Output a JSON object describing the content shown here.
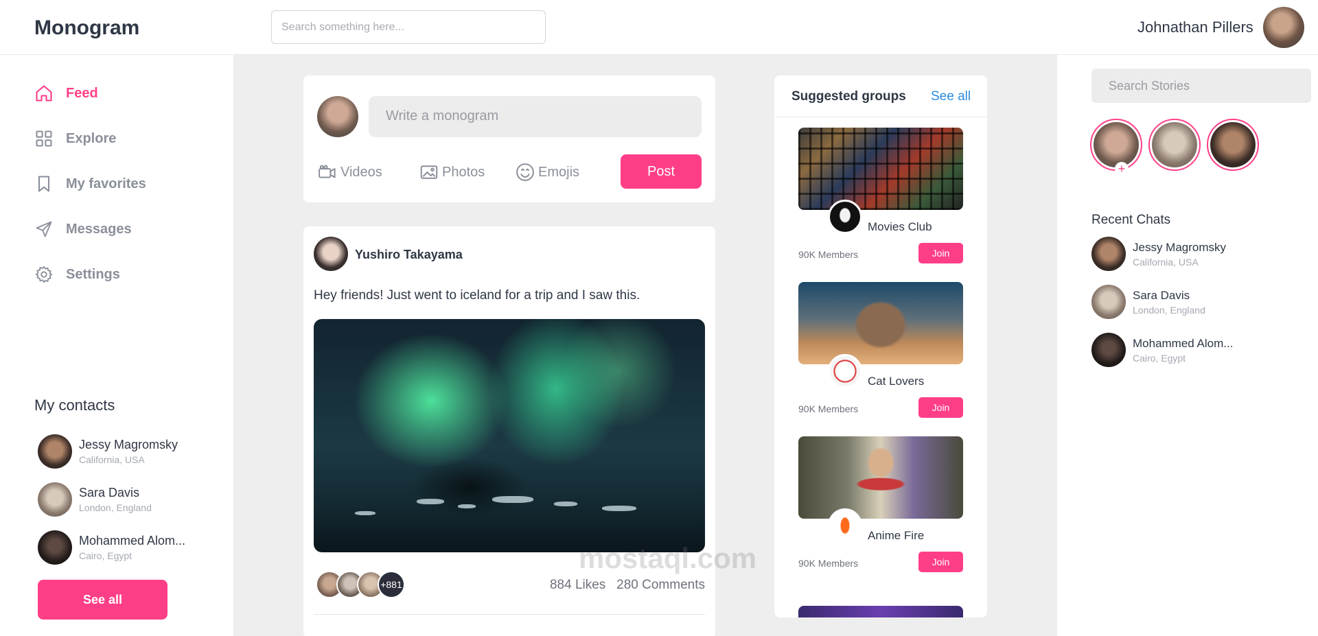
{
  "app": {
    "logo": "Monogram"
  },
  "header": {
    "search_placeholder": "Search something here...",
    "user_name": "Johnathan Pillers"
  },
  "nav": [
    {
      "label": "Feed",
      "icon": "home-icon",
      "active": true
    },
    {
      "label": "Explore",
      "icon": "grid-icon",
      "active": false
    },
    {
      "label": "My favorites",
      "icon": "bookmark-icon",
      "active": false
    },
    {
      "label": "Messages",
      "icon": "send-icon",
      "active": false
    },
    {
      "label": "Settings",
      "icon": "gear-icon",
      "active": false
    }
  ],
  "contacts": {
    "title": "My contacts",
    "items": [
      {
        "name": "Jessy Magromsky",
        "location": "California, USA"
      },
      {
        "name": "Sara Davis",
        "location": "London, England"
      },
      {
        "name": "Mohammed Alom...",
        "location": "Cairo, Egypt"
      }
    ],
    "see_all_label": "See all"
  },
  "composer": {
    "placeholder": "Write a monogram",
    "actions": [
      "Videos",
      "Photos",
      "Emojis"
    ],
    "post_label": "Post"
  },
  "post": {
    "author": "Yushiro Takayama",
    "text": "Hey friends! Just went to iceland for a trip and I saw this.",
    "likers_more": "+881",
    "likes": "884 Likes",
    "comments": "280 Comments"
  },
  "groups": {
    "title": "Suggested groups",
    "see_all_label": "See all",
    "items": [
      {
        "name": "Movies Club",
        "members": "90K Members",
        "join_label": "Join"
      },
      {
        "name": "Cat Lovers",
        "members": "90K Members",
        "join_label": "Join"
      },
      {
        "name": "Anime Fire",
        "members": "90K Members",
        "join_label": "Join"
      }
    ]
  },
  "stories": {
    "search_placeholder": "Search Stories",
    "add_symbol": "+"
  },
  "recent_chats": {
    "title": "Recent Chats",
    "items": [
      {
        "name": "Jessy Magromsky",
        "location": "California, USA"
      },
      {
        "name": "Sara Davis",
        "location": "London, England"
      },
      {
        "name": "Mohammed Alom...",
        "location": "Cairo, Egypt"
      }
    ]
  },
  "watermark": "mostaql.com",
  "colors": {
    "accent": "#ff3e88",
    "link": "#2a8be0",
    "background": "#eeeeee",
    "text": "#2f3745"
  }
}
